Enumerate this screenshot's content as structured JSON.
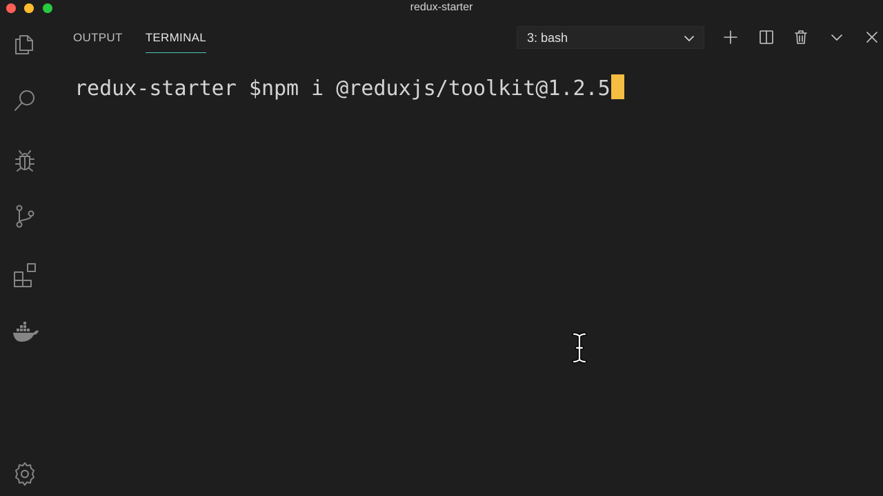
{
  "window": {
    "title": "redux-starter"
  },
  "activity_bar": {
    "icons": [
      "files-icon",
      "search-icon",
      "debug-icon",
      "source-control-icon",
      "extensions-icon",
      "docker-icon",
      "settings-gear-icon"
    ]
  },
  "panel": {
    "tabs": [
      {
        "label": "OUTPUT",
        "active": false
      },
      {
        "label": "TERMINAL",
        "active": true
      }
    ],
    "terminal_select": {
      "selected": "3: bash"
    },
    "toolbar_icons": [
      "plus-icon",
      "split-icon",
      "trash-icon",
      "chevron-down-icon",
      "close-icon"
    ]
  },
  "terminal": {
    "prompt": "redux-starter $",
    "command": "npm i @reduxjs/toolkit@1.2.5"
  },
  "colors": {
    "background": "#1e1e1e",
    "cursor": "#f5bd41",
    "active_tab_underline": "#4ec9b0"
  }
}
